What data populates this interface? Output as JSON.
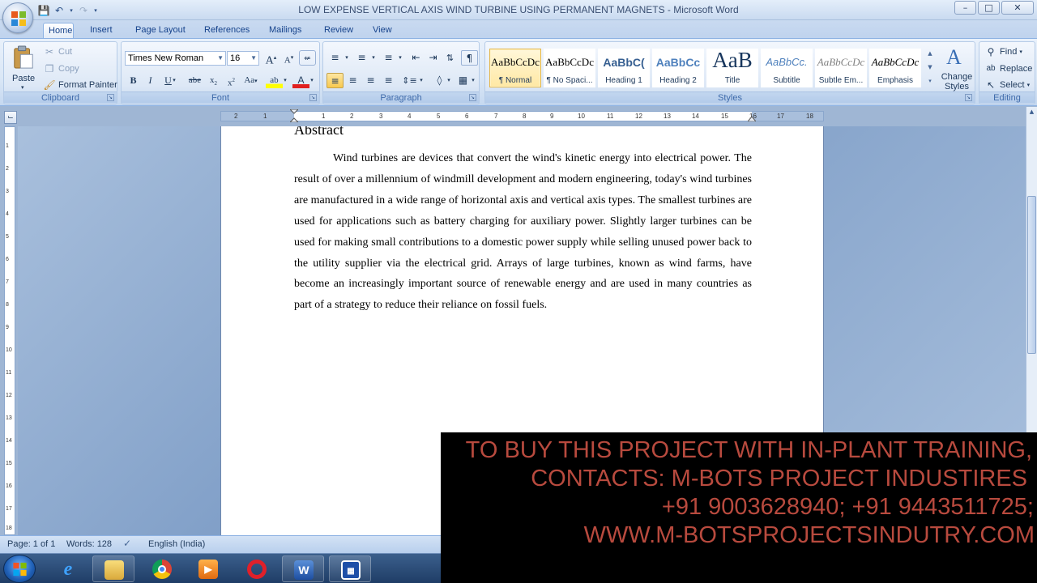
{
  "window": {
    "title": "LOW EXPENSE VERTICAL AXIS WIND TURBINE USING PERMANENT MAGNETS - Microsoft Word",
    "minimize": "–",
    "maximize": "□",
    "close": "✕"
  },
  "tabs": [
    "Home",
    "Insert",
    "Page Layout",
    "References",
    "Mailings",
    "Review",
    "View"
  ],
  "clipboard": {
    "paste": "Paste",
    "cut": "Cut",
    "copy": "Copy",
    "format_painter": "Format Painter",
    "label": "Clipboard"
  },
  "font": {
    "family": "Times New Roman",
    "size": "16",
    "label": "Font"
  },
  "paragraph": {
    "label": "Paragraph"
  },
  "styles": {
    "items": [
      {
        "preview": "AaBbCcDc",
        "name": "¶ Normal"
      },
      {
        "preview": "AaBbCcDc",
        "name": "¶ No Spaci..."
      },
      {
        "preview": "AaBbC(",
        "name": "Heading 1"
      },
      {
        "preview": "AaBbCc",
        "name": "Heading 2"
      },
      {
        "preview": "AaB",
        "name": "Title"
      },
      {
        "preview": "AaBbCc.",
        "name": "Subtitle"
      },
      {
        "preview": "AaBbCcDc",
        "name": "Subtle Em..."
      },
      {
        "preview": "AaBbCcDc",
        "name": "Emphasis"
      }
    ],
    "change_styles": "Change Styles",
    "label": "Styles"
  },
  "editing": {
    "find": "Find",
    "replace": "Replace",
    "select": "Select",
    "label": "Editing"
  },
  "ruler": {
    "marks": [
      "2",
      "1",
      "1",
      "2",
      "3",
      "4",
      "5",
      "6",
      "7",
      "8",
      "9",
      "10",
      "11",
      "12",
      "13",
      "14",
      "15",
      "16",
      "17",
      "18"
    ]
  },
  "vruler": {
    "marks": [
      "1",
      "2",
      "3",
      "4",
      "5",
      "6",
      "7",
      "8",
      "9",
      "10",
      "11",
      "12",
      "13",
      "14",
      "15",
      "16",
      "17",
      "18"
    ]
  },
  "document": {
    "heading": "Abstract",
    "paragraph": "Wind turbines are devices that convert the wind's kinetic energy into electrical power. The result of over a millennium of windmill development and modern engineering, today's wind turbines are manufactured in a wide range of horizontal axis and vertical axis types. The smallest turbines are used for applications such as battery charging for auxiliary power. Slightly larger turbines can be used for making small contributions to a domestic power supply while selling unused power back to the utility supplier via the electrical grid. Arrays of large turbines, known as wind farms, have become an increasingly important source of renewable energy and are used in many countries as part of a strategy to reduce their reliance on fossil fuels."
  },
  "status": {
    "page": "Page: 1 of 1",
    "words": "Words: 128",
    "language": "English (India)"
  },
  "banner": {
    "lines": [
      "TO BUY THIS PROJECT WITH IN-PLANT TRAINING,",
      "CONTACTS: M-BOTS PROJECT INDUSTIRES",
      "+91 9003628940; +91 9443511725;",
      "WWW.M-BOTSPROJECTSINDUTRY.COM"
    ],
    "color": "#b84a3e"
  }
}
